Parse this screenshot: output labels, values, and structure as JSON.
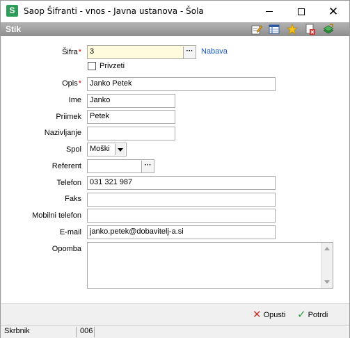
{
  "window": {
    "title": "Saop Šifranti - vnos - Javna ustanova - Šola",
    "app_icon_letter": "S"
  },
  "panel": {
    "title": "Stik"
  },
  "form": {
    "sifra": {
      "label": "Šifra",
      "value": "3",
      "link": "Nabava"
    },
    "privzeti": {
      "label": "Privzeti",
      "checked": false
    },
    "opis": {
      "label": "Opis",
      "value": "Janko Petek"
    },
    "ime": {
      "label": "Ime",
      "value": "Janko"
    },
    "priimek": {
      "label": "Priimek",
      "value": "Petek"
    },
    "nazivljanje": {
      "label": "Nazivljanje",
      "value": ""
    },
    "spol": {
      "label": "Spol",
      "value": "Moški"
    },
    "referent": {
      "label": "Referent",
      "value": ""
    },
    "telefon": {
      "label": "Telefon",
      "value": "031 321 987"
    },
    "faks": {
      "label": "Faks",
      "value": ""
    },
    "mobilni": {
      "label": "Mobilni telefon",
      "value": ""
    },
    "email": {
      "label": "E-mail",
      "value": "janko.petek@dobavitelj-a.si"
    },
    "opomba": {
      "label": "Opomba",
      "value": ""
    },
    "required_marker": "*"
  },
  "actions": {
    "cancel_label": "Opusti",
    "confirm_label": "Potrdi"
  },
  "status": {
    "user": "Skrbnik",
    "code": "006"
  },
  "colors": {
    "required": "#cc0000",
    "link": "#1a57c9",
    "highlight_field": "#fffbdc",
    "panel_bar": "#8e8e8e",
    "cancel_icon": "#d0312d",
    "confirm_icon": "#2a9d3a"
  }
}
